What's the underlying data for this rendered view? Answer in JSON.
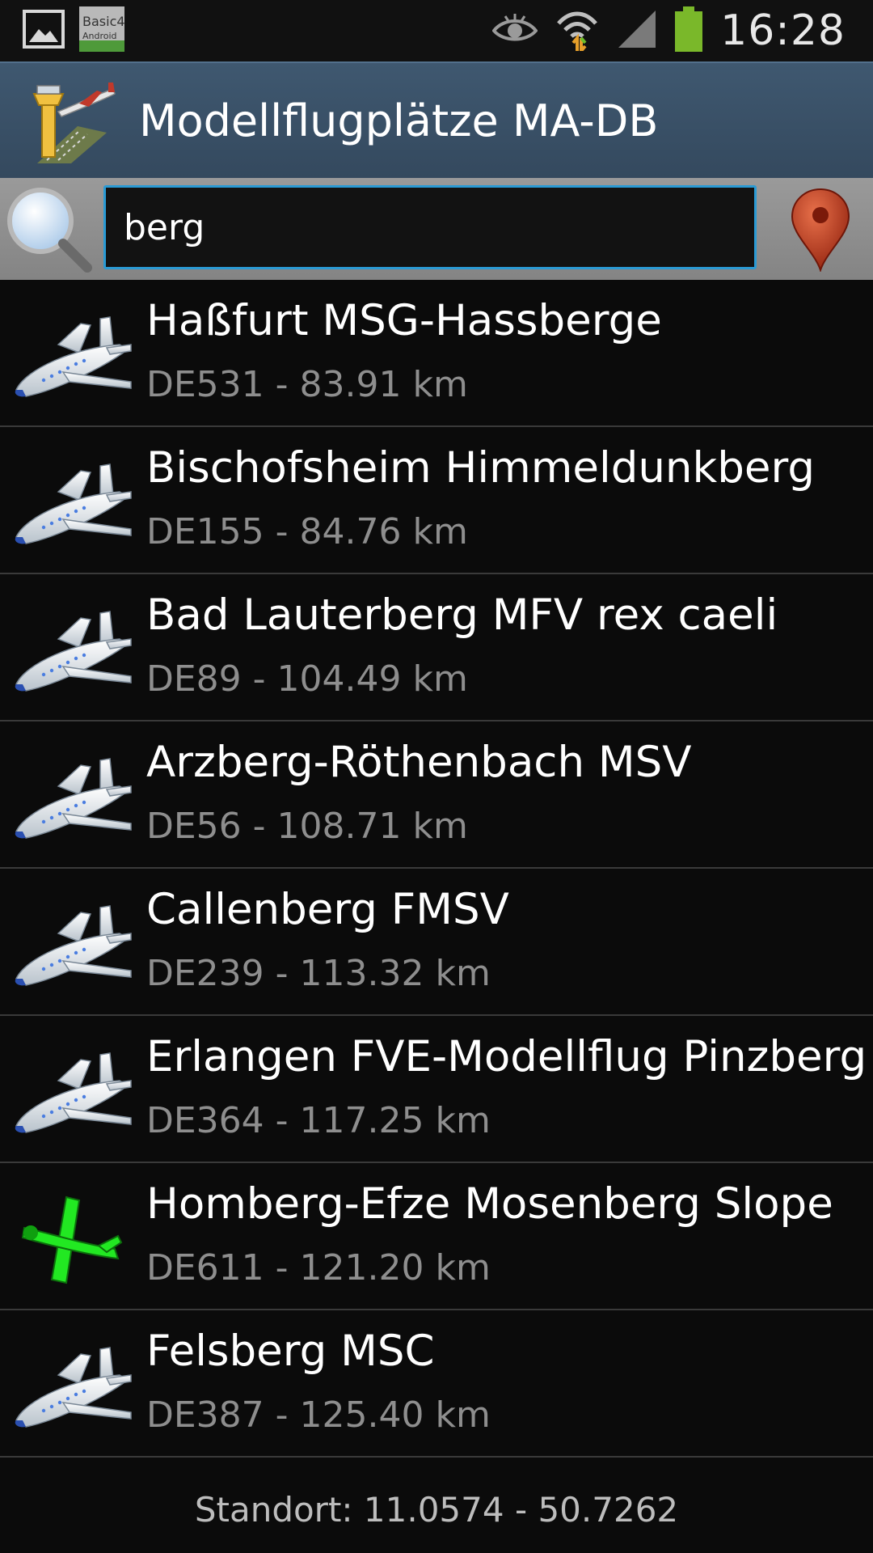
{
  "status_bar": {
    "time": "16:28",
    "left_icons": [
      "gallery-icon",
      "basic4android-icon"
    ],
    "right_icons": [
      "eye-icon",
      "wifi-icon",
      "signal-icon",
      "battery-icon"
    ]
  },
  "action_bar": {
    "title": "Modellflugplätze MA-DB",
    "logo_icon": "airfield-tower-icon"
  },
  "search": {
    "value": "berg",
    "search_icon": "magnifier-icon",
    "location_icon": "map-pin-icon"
  },
  "results": [
    {
      "name": "Haßfurt MSG-Hassberge",
      "detail": "DE531 - 83.91 km",
      "icon": "plane-icon"
    },
    {
      "name": "Bischofsheim Himmeldunkberg",
      "detail": "DE155 - 84.76 km",
      "icon": "plane-icon"
    },
    {
      "name": "Bad Lauterberg MFV rex caeli",
      "detail": "DE89 - 104.49 km",
      "icon": "plane-icon"
    },
    {
      "name": "Arzberg-Röthenbach MSV",
      "detail": "DE56 - 108.71 km",
      "icon": "plane-icon"
    },
    {
      "name": "Callenberg FMSV",
      "detail": "DE239 - 113.32 km",
      "icon": "plane-icon"
    },
    {
      "name": "Erlangen FVE-Modellflug Pinzberg",
      "detail": "DE364 - 117.25 km",
      "icon": "plane-icon"
    },
    {
      "name": "Homberg-Efze Mosenberg Slope",
      "detail": "DE611 - 121.20 km",
      "icon": "glider-icon"
    },
    {
      "name": "Felsberg MSC",
      "detail": "DE387 - 125.40 km",
      "icon": "plane-icon"
    }
  ],
  "footer": {
    "location_text": "Standort: 11.0574 - 50.7262"
  },
  "colors": {
    "action_bar": "#3b5269",
    "search_bar": "#8f8f8f",
    "input_border": "#2a9ad4",
    "background": "#0b0b0b",
    "subtitle": "#8e8e8e",
    "glider": "#22e822"
  }
}
